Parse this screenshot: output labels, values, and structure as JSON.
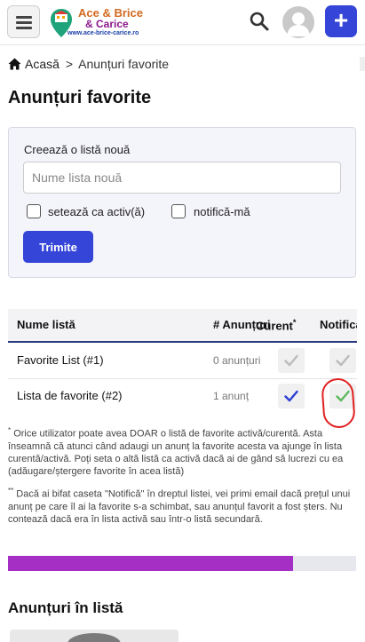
{
  "header": {
    "logo_line1": "Ace & Brice",
    "logo_line2": "& Carice",
    "logo_url": "www.ace-brice-carice.ro",
    "plus_label": "+"
  },
  "breadcrumb": {
    "home": "Acasă",
    "separator": ">",
    "current": "Anunțuri favorite"
  },
  "page_title": "Anunțuri favorite",
  "new_list_form": {
    "label": "Creează o listă nouă",
    "input_placeholder": "Nume lista nouă",
    "input_value": "",
    "checkbox_active_label": "setează ca activ(ă)",
    "checkbox_notify_label": "notifică-mă",
    "submit_label": "Trimite"
  },
  "table": {
    "headers": {
      "name": "Nume listă",
      "count": "# Anunțuri",
      "current": "Curent",
      "current_mark": "*",
      "notify": "Notifică"
    },
    "rows": [
      {
        "name": "Favorite List (#1)",
        "count": "0 anunțuri",
        "current": false,
        "notify": false
      },
      {
        "name": "Lista de favorite (#2)",
        "count": "1 anunț",
        "current": true,
        "notify": true
      }
    ]
  },
  "notes": {
    "note1_mark": "*",
    "note1": "Orice utilizator poate avea DOAR o listă de favorite activă/curentă. Asta înseamnă că atunci când adaugi un anunț la favorite acesta va ajunge în lista curentă/activă. Poți seta o altă listă ca activă dacă ai de gând să lucrezi cu ea (adăugare/ștergere favorite în acea listă)",
    "note2_mark": "**",
    "note2": "Dacă ai bifat caseta \"Notifică\" în dreptul listei, vei primi email dacă prețul unui anunț pe care îl ai la favorite s-a schimbat, sau anunțul favorit a fost șters. Nu contează dacă era în lista activă sau într-o listă secundară."
  },
  "progress": {
    "fraction": 0.82
  },
  "section_title": "Anunțuri în listă",
  "colors": {
    "accent": "#3545d8",
    "progress": "#a52ec4",
    "check_blue": "#2b3fd1",
    "check_green": "#5cb85c",
    "check_gray": "#bbbbbb",
    "annotation_red": "#e02020"
  }
}
